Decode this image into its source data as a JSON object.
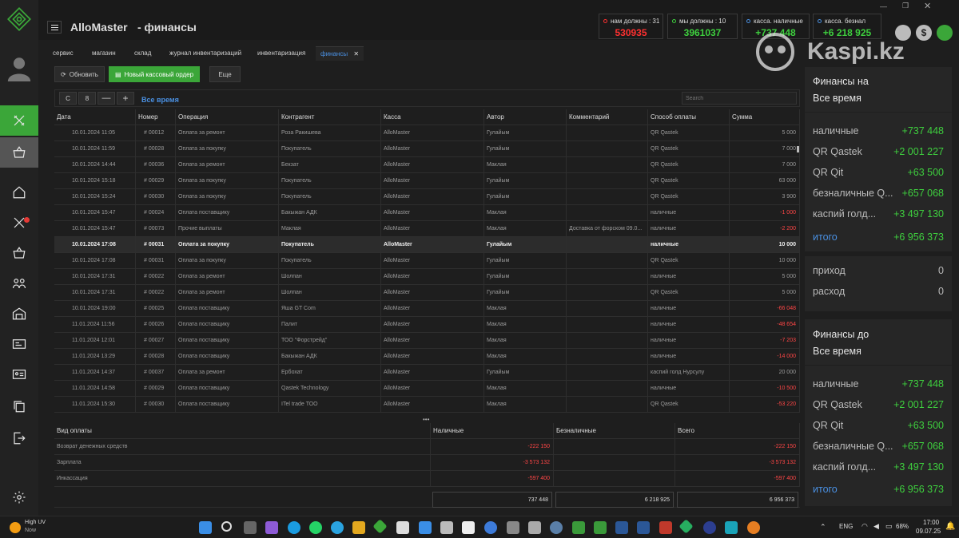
{
  "window": {
    "app_name": "AlloMaster",
    "page_title": "- финансы"
  },
  "stats": [
    {
      "label": "нам должны : 31",
      "value": "530935",
      "color": "#ff3030"
    },
    {
      "label": "мы должны : 10",
      "value": "3961037",
      "color": "#3ecf3e"
    },
    {
      "label": "касса. наличные",
      "value": "+737 448",
      "color": "#3ecf3e"
    },
    {
      "label": "касса. безнал",
      "value": "+6 218 925",
      "color": "#3ecf3e"
    }
  ],
  "watermark": "Kaspi.kz",
  "tabs": [
    "сервис",
    "магазин",
    "склад",
    "журнал инвентаризаций",
    "инвентаризация",
    "финансы"
  ],
  "toolbar": {
    "refresh_label": "Обновить",
    "new_order_label": "Новый кассовый ордер",
    "more_label": "Еще",
    "from_label": "С",
    "to_label": "8",
    "minus_label": "—",
    "plus_label": "+",
    "period_label": "Все время",
    "search_placeholder": "Search"
  },
  "grid": {
    "columns": [
      "Дата",
      "Номер",
      "Операция",
      "Контрагент",
      "Касса",
      "Автор",
      "Комментарий",
      "Способ оплаты",
      "Сумма"
    ],
    "rows": [
      [
        "10.01.2024 11:05",
        "# 00012",
        "Оплата за ремонт",
        "Роза Ракишева",
        "AlloMaster",
        "Гулайым",
        "",
        "QR Qastek",
        "5 000"
      ],
      [
        "10.01.2024 11:59",
        "# 00028",
        "Оплата за покупку",
        "Покупатель",
        "AlloMaster",
        "Гулайым",
        "",
        "QR Qastek",
        "7 000"
      ],
      [
        "10.01.2024 14:44",
        "# 00036",
        "Оплата за ремонт",
        "Бекзат",
        "AlloMaster",
        "Маклая",
        "",
        "QR Qastek",
        "7 000"
      ],
      [
        "10.01.2024 15:18",
        "# 00029",
        "Оплата за покупку",
        "Покупатель",
        "AlloMaster",
        "Гулайым",
        "",
        "QR Qastek",
        "63 000"
      ],
      [
        "10.01.2024 15:24",
        "# 00030",
        "Оплата за покупку",
        "Покупатель",
        "AlloMaster",
        "Гулайым",
        "",
        "QR Qastek",
        "3 900"
      ],
      [
        "10.01.2024 15:47",
        "# 00024",
        "Оплата поставщику",
        "Бакыжан АДК",
        "AlloMaster",
        "Маклая",
        "",
        "наличные",
        "-1 000"
      ],
      [
        "10.01.2024 15:47",
        "# 00073",
        "Прочие выплаты",
        "Маклая",
        "AlloMaster",
        "Маклая",
        "Доставка от форском 09.0...",
        "наличные",
        "-2 200"
      ],
      [
        "10.01.2024 17:08",
        "# 00031",
        "Оплата за покупку",
        "Покупатель",
        "AlloMaster",
        "Гулайым",
        "",
        "наличные",
        "10 000"
      ],
      [
        "10.01.2024 17:08",
        "# 00031",
        "Оплата за покупку",
        "Покупатель",
        "AlloMaster",
        "Гулайым",
        "",
        "QR Qastek",
        "10 000"
      ],
      [
        "10.01.2024 17:31",
        "# 00022",
        "Оплата за ремонт",
        "Шолпан",
        "AlloMaster",
        "Гулайым",
        "",
        "наличные",
        "5 000"
      ],
      [
        "10.01.2024 17:31",
        "# 00022",
        "Оплата за ремонт",
        "Шолпан",
        "AlloMaster",
        "Гулайым",
        "",
        "QR Qastek",
        "5 000"
      ],
      [
        "10.01.2024 19:00",
        "# 00025",
        "Оплата поставщику",
        "Яша GT Com",
        "AlloMaster",
        "Маклая",
        "",
        "наличные",
        "-66 048"
      ],
      [
        "11.01.2024 11:56",
        "# 00026",
        "Оплата поставщику",
        "Палит",
        "AlloMaster",
        "Маклая",
        "",
        "наличные",
        "-48 654"
      ],
      [
        "11.01.2024 12:01",
        "# 00027",
        "Оплата поставщику",
        "ТОО \"Форстрейд\"",
        "AlloMaster",
        "Маклая",
        "",
        "наличные",
        "-7 203"
      ],
      [
        "11.01.2024 13:29",
        "# 00028",
        "Оплата поставщику",
        "Бакыжан АДК",
        "AlloMaster",
        "Маклая",
        "",
        "наличные",
        "-14 000"
      ],
      [
        "11.01.2024 14:37",
        "# 00037",
        "Оплата за ремонт",
        "Ербохат",
        "AlloMaster",
        "Гулайым",
        "",
        "каспий голд Нурсулу",
        "20 000"
      ],
      [
        "11.01.2024 14:58",
        "# 00029",
        "Оплата поставщику",
        "Qastek Technology",
        "AlloMaster",
        "Маклая",
        "",
        "наличные",
        "-10 500"
      ],
      [
        "11.01.2024 15:30",
        "# 00030",
        "Оплата поставщику",
        "ITel trade ТОО",
        "AlloMaster",
        "Маклая",
        "",
        "QR Qastek",
        "-53 220"
      ]
    ],
    "selected_row": 7
  },
  "summary": {
    "columns": [
      "Вид оплаты",
      "Наличные",
      "Безналичные",
      "Всего"
    ],
    "rows": [
      [
        "Возврат денежных средств",
        "-222 150",
        "",
        "-222 150"
      ],
      [
        "Зарплата",
        "-3 573 132",
        "",
        "-3 573 132"
      ],
      [
        "Инкассация",
        "-597 400",
        "",
        "-597 400"
      ]
    ],
    "totals": [
      "",
      "737 448",
      "6 218 925",
      "6 956 373"
    ]
  },
  "panel_top": {
    "title": "Финансы на",
    "period": "Все время",
    "items": [
      {
        "k": "наличные",
        "v": "+737 448"
      },
      {
        "k": "QR Qastek",
        "v": "+2 001 227"
      },
      {
        "k": "QR Qit",
        "v": "+63 500"
      },
      {
        "k": "безналичные Q...",
        "v": "+657 068"
      },
      {
        "k": "каспий голд...",
        "v": "+3 497 130"
      }
    ],
    "total_label": "итого",
    "total_value": "+6 956 373",
    "income_label": "приход",
    "income_value": "0",
    "expense_label": "расход",
    "expense_value": "0"
  },
  "panel_bottom": {
    "title": "Финансы до",
    "period": "Все время",
    "items": [
      {
        "k": "наличные",
        "v": "+737 448"
      },
      {
        "k": "QR Qastek",
        "v": "+2 001 227"
      },
      {
        "k": "QR Qit",
        "v": "+63 500"
      },
      {
        "k": "безналичные Q...",
        "v": "+657 068"
      },
      {
        "k": "каспий голд...",
        "v": "+3 497 130"
      }
    ],
    "total_label": "итого",
    "total_value": "+6 956 373"
  },
  "taskbar": {
    "weather_title": "High UV",
    "weather_sub": "Now",
    "lang": "ENG",
    "battery": "68%",
    "time": "17:00",
    "date": "09.07.25"
  },
  "colors": {
    "accent_green": "#3ba639",
    "positive": "#3ecf3e",
    "negative": "#ff4646",
    "link": "#4a90e2"
  }
}
